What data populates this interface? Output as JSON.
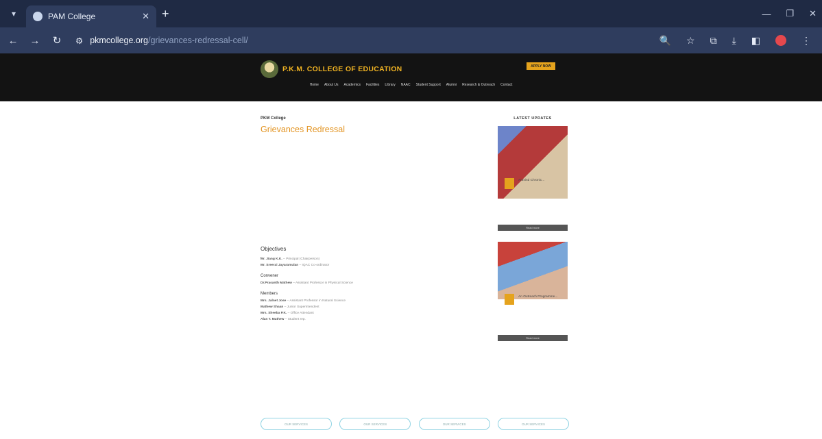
{
  "browser": {
    "tab_title": "PAM College",
    "url_host": "pkmcollege.org",
    "url_path": "/grievances-redressal-cell/"
  },
  "site": {
    "college_name": "P.K.M. COLLEGE OF EDUCATION",
    "apply_label": "APPLY NOW",
    "nav": [
      "Home",
      "About Us",
      "Academics",
      "Facilities",
      "Library",
      "NAAC",
      "Student Support",
      "Alumni",
      "Research & Outreach",
      "Contact"
    ]
  },
  "page": {
    "breadcrumb": "PKM College",
    "title": "Grievances Redressal",
    "objectives_heading": "Objectives",
    "convener_heading": "Convener",
    "members_heading": "Members",
    "principal": {
      "name": "Mr. Jiang K.K.",
      "role": "Principal (Chairperson)"
    },
    "coordinator": {
      "name": "Mr. Sreerai Jayaramulan",
      "role": "IQAC Co-ordinator"
    },
    "convener": {
      "name": "Dr.Prasanth Mathew",
      "role": "Assistant Professor in Physical Science"
    },
    "members": [
      {
        "name": "Mrs. Jalnet Jose",
        "role": "Assistant Professor in Natural Science"
      },
      {
        "name": "Mathew Shaan",
        "role": "Junior Superintendent"
      },
      {
        "name": "Mrs. Sheeba P.K.",
        "role": "Office Attendant"
      },
      {
        "name": "Alan T. Mathew",
        "role": "Student rep."
      }
    ],
    "pills": [
      "OUR SERVICES",
      "OUR SERVICES",
      "OUR SERVICES",
      "OUR SERVICES"
    ]
  },
  "sidebar": {
    "title": "LATEST UPDATES",
    "cards": [
      {
        "title": "Aravind Chronic...",
        "read_more": "Read more"
      },
      {
        "title": "An Outreach Programme...",
        "read_more": "Read more"
      }
    ]
  }
}
